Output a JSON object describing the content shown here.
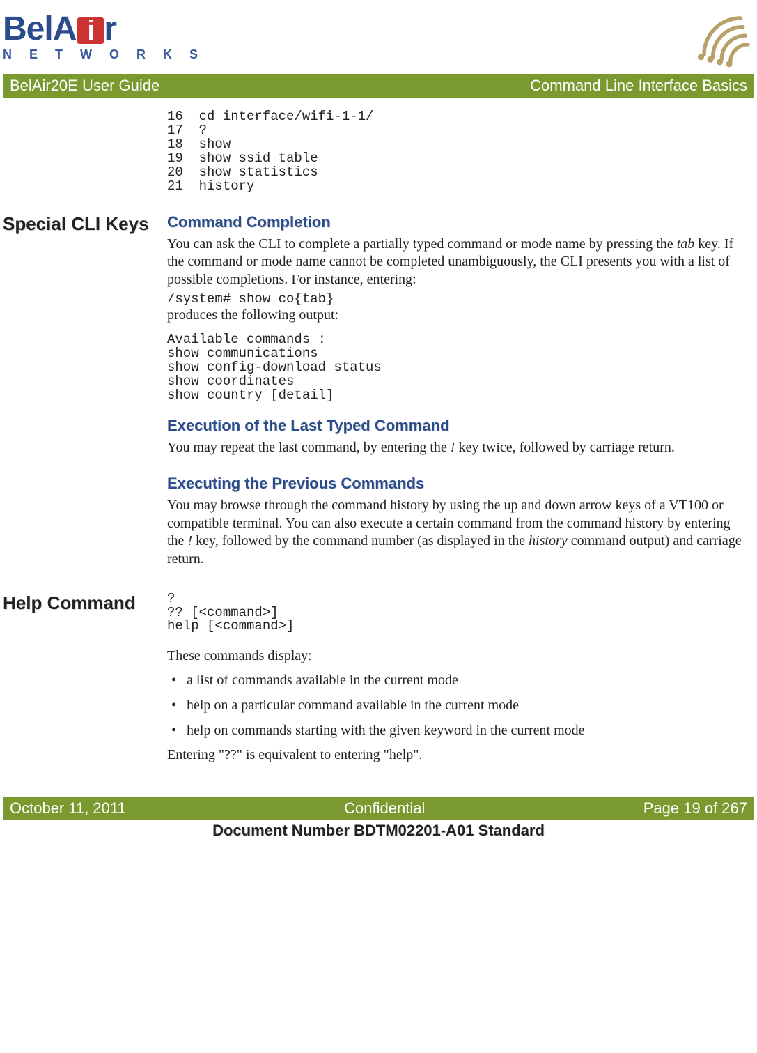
{
  "logo": {
    "brand": "BelAir",
    "sub": "N E T W O R K S"
  },
  "topbar": {
    "left": "BelAir20E User Guide",
    "right": "Command Line Interface Basics"
  },
  "code1": "16  cd interface/wifi-1-1/\n17  ?\n18  show\n19  show ssid table\n20  show statistics\n21  history",
  "section1": {
    "side": "Special CLI Keys",
    "h1": "Command Completion",
    "p1a": "You can ask the CLI to complete a partially typed command or mode name by pressing the ",
    "p1tab": "tab",
    "p1b": " key. If the command or mode name cannot be completed unambiguously, the CLI presents you with a list of possible completions. For instance, entering:",
    "code2": "/system# show co{tab}",
    "p2": "produces the following output:",
    "code3": "Available commands :\nshow communications\nshow config-download status\nshow coordinates\nshow country [detail]",
    "h2": "Execution of the Last Typed Command",
    "p3a": "You may repeat the last command, by entering the ",
    "p3bang": "!",
    "p3b": " key twice, followed by carriage return.",
    "h3": "Executing the Previous Commands",
    "p4a": "You may browse through the command history by using the up and down arrow keys of a VT100 or compatible terminal. You can also execute a certain command from the command history by entering the ",
    "p4bang": "!",
    "p4b": " key, followed by the command number (as displayed in the ",
    "p4hist": "history",
    "p4c": " command output) and carriage return."
  },
  "section2": {
    "side": "Help Command",
    "code4": "?\n?? [<command>]\nhelp [<command>]",
    "p5": "These commands display:",
    "bullets": [
      "a list of commands available in the current mode",
      "help on a particular command available in the current mode",
      "help on commands starting with the given keyword in the current mode"
    ],
    "p6": "Entering \"??\" is equivalent to entering \"help\"."
  },
  "footer": {
    "left": "October 11, 2011",
    "center": "Confidential",
    "right": "Page 19 of 267"
  },
  "docnum": "Document Number BDTM02201-A01 Standard"
}
